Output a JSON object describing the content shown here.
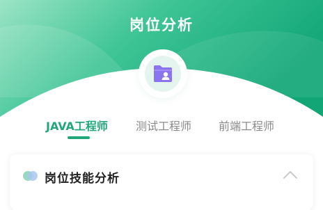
{
  "header": {
    "title": "岗位分析",
    "icon": "folder-user-icon",
    "colors": {
      "gradient_light": "#8fe0c0",
      "gradient_mid": "#3cc494",
      "gradient_dark": "#13a678"
    }
  },
  "tabs": [
    {
      "label": "JAVA工程师",
      "active": true
    },
    {
      "label": "测试工程师",
      "active": false
    },
    {
      "label": "前端工程师",
      "active": false
    }
  ],
  "colors": {
    "accent": "#21a77a",
    "inactive_tab": "#8a8a8a",
    "icon_purple": "#8b74f0"
  },
  "card": {
    "title": "岗位技能分析",
    "icon": "double-circle-icon",
    "toggle_icon": "chevron-up-icon"
  }
}
